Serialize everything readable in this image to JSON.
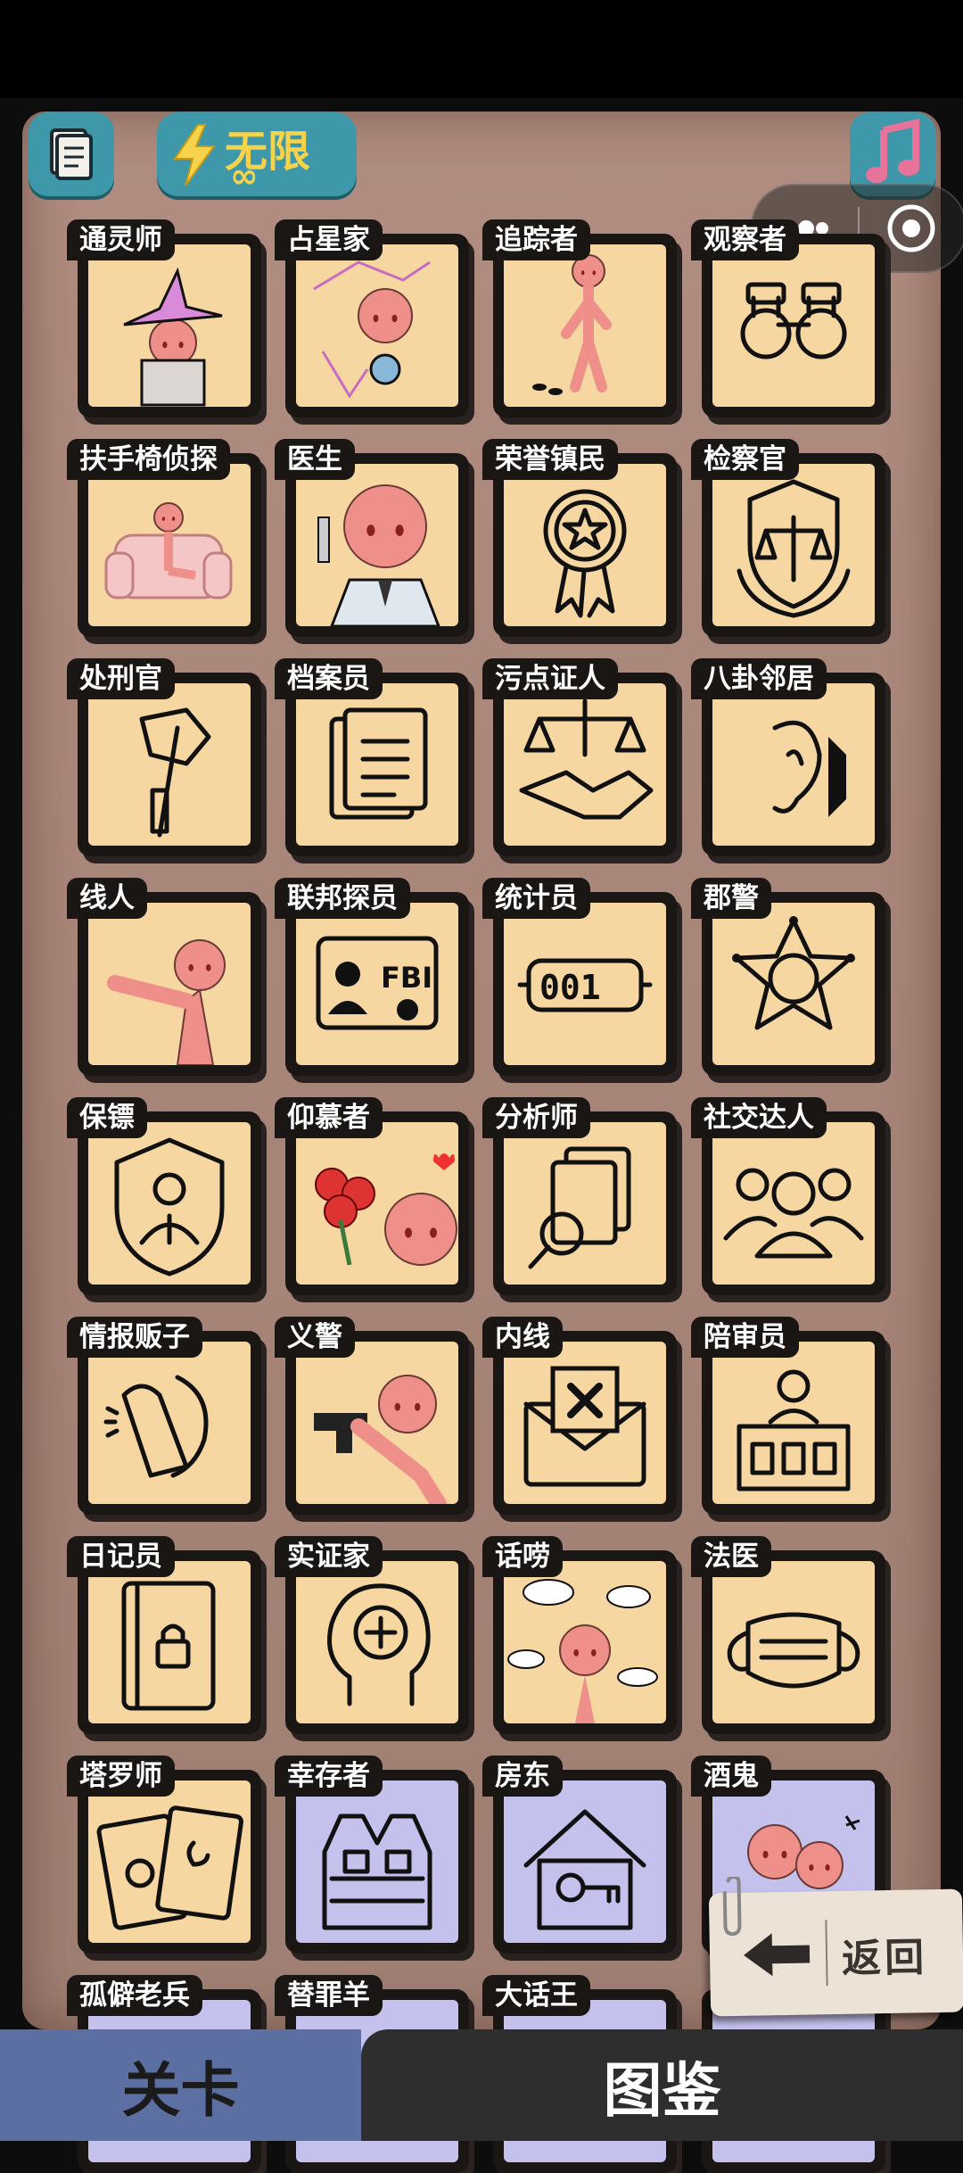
{
  "top_bar": {
    "energy_label": "无限",
    "energy_sub": "∞",
    "icons": [
      "cards-icon",
      "lightning-icon",
      "music-icon",
      "more-icon",
      "record-icon"
    ]
  },
  "cards": [
    {
      "name": "通灵师",
      "bg": "peach",
      "icon": "medium-icon"
    },
    {
      "name": "占星家",
      "bg": "peach",
      "icon": "astrologer-icon"
    },
    {
      "name": "追踪者",
      "bg": "peach",
      "icon": "tracker-icon"
    },
    {
      "name": "观察者",
      "bg": "peach",
      "icon": "binoculars-icon"
    },
    {
      "name": "扶手椅侦探",
      "bg": "peach",
      "icon": "armchair-icon"
    },
    {
      "name": "医生",
      "bg": "peach",
      "icon": "doctor-icon"
    },
    {
      "name": "荣誉镇民",
      "bg": "peach",
      "icon": "medal-icon"
    },
    {
      "name": "检察官",
      "bg": "peach",
      "icon": "scales-badge-icon"
    },
    {
      "name": "处刑官",
      "bg": "peach",
      "icon": "axe-icon"
    },
    {
      "name": "档案员",
      "bg": "peach",
      "icon": "documents-icon"
    },
    {
      "name": "污点证人",
      "bg": "peach",
      "icon": "handshake-scales-icon"
    },
    {
      "name": "八卦邻居",
      "bg": "peach",
      "icon": "ear-icon"
    },
    {
      "name": "线人",
      "bg": "peach",
      "icon": "pointing-icon"
    },
    {
      "name": "联邦探员",
      "bg": "peach",
      "icon": "fbi-badge-icon"
    },
    {
      "name": "统计员",
      "bg": "peach",
      "icon": "counter-icon"
    },
    {
      "name": "郡警",
      "bg": "peach",
      "icon": "sheriff-star-icon"
    },
    {
      "name": "保镖",
      "bg": "peach",
      "icon": "shield-person-icon"
    },
    {
      "name": "仰慕者",
      "bg": "peach",
      "icon": "roses-icon"
    },
    {
      "name": "分析师",
      "bg": "peach",
      "icon": "magnifier-docs-icon"
    },
    {
      "name": "社交达人",
      "bg": "peach",
      "icon": "people-group-icon"
    },
    {
      "name": "情报贩子",
      "bg": "peach",
      "icon": "whisper-icon"
    },
    {
      "name": "义警",
      "bg": "peach",
      "icon": "gun-icon"
    },
    {
      "name": "内线",
      "bg": "peach",
      "icon": "envelope-x-icon"
    },
    {
      "name": "陪审员",
      "bg": "peach",
      "icon": "jury-box-icon"
    },
    {
      "name": "日记员",
      "bg": "peach",
      "icon": "diary-lock-icon"
    },
    {
      "name": "实证家",
      "bg": "peach",
      "icon": "head-plus-icon"
    },
    {
      "name": "话唠",
      "bg": "peach",
      "icon": "chatter-icon"
    },
    {
      "name": "法医",
      "bg": "peach",
      "icon": "mask-icon"
    },
    {
      "name": "塔罗师",
      "bg": "peach",
      "icon": "tarot-icon"
    },
    {
      "name": "幸存者",
      "bg": "lav",
      "icon": "vest-icon"
    },
    {
      "name": "房东",
      "bg": "lav",
      "icon": "house-key-icon"
    },
    {
      "name": "酒鬼",
      "bg": "lav",
      "icon": "drunk-icon"
    },
    {
      "name": "孤僻老兵",
      "bg": "lav",
      "icon": "veteran-icon"
    },
    {
      "name": "替罪羊",
      "bg": "lav",
      "icon": "scapegoat-icon"
    },
    {
      "name": "大话王",
      "bg": "lav",
      "icon": "liar-icon"
    },
    {
      "name": "",
      "bg": "lav",
      "icon": "unknown-icon"
    }
  ],
  "back_button": {
    "label": "返回"
  },
  "bottom_tabs": {
    "left": "关卡",
    "right": "图鉴"
  }
}
